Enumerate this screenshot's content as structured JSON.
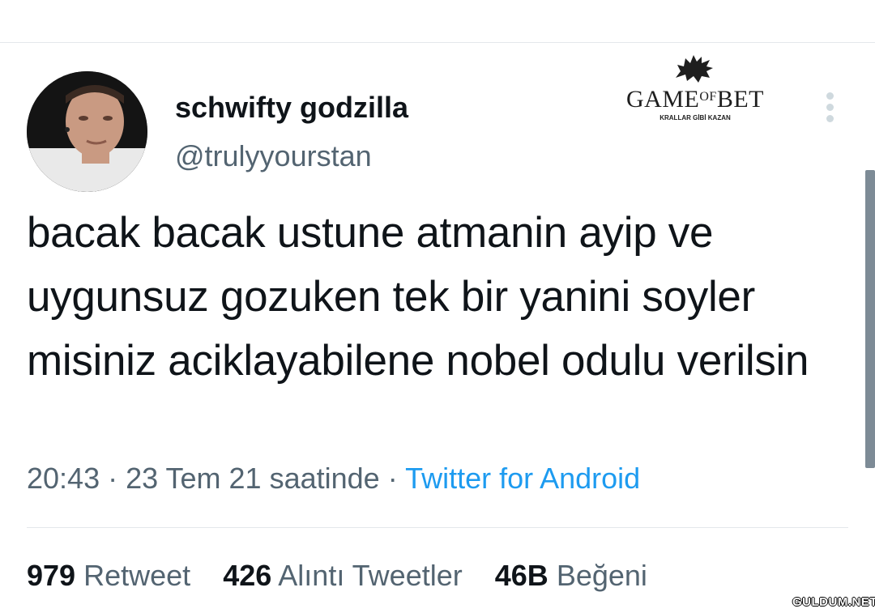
{
  "tweet": {
    "author": {
      "display_name": "schwifty godzilla",
      "handle": "@trulyyourstan"
    },
    "text": "bacak bacak ustune atmanin ayip ve uygunsuz gozuken tek bir yanini soyler misiniz aciklayabilene nobel odulu verilsin",
    "meta": {
      "time": "20:43",
      "separator": "·",
      "date": "23 Tem 21 saatinde",
      "source": "Twitter for Android"
    },
    "stats": [
      {
        "count": "979",
        "label": "Retweet"
      },
      {
        "count": "426",
        "label": "Alıntı Tweetler"
      },
      {
        "count": "46B",
        "label": "Beğeni"
      }
    ]
  },
  "sponsor": {
    "wordmark_left": "GAME",
    "wordmark_of": "OF",
    "wordmark_right": "BET",
    "tagline": "KRALLAR GİBİ KAZAN",
    "icon": "wolf-icon"
  },
  "icons": {
    "more": "more-vertical-icon"
  },
  "watermark": "GULDUM.NET",
  "colors": {
    "primary_text": "#0f1419",
    "secondary_text": "#536471",
    "link": "#1d9bf0",
    "divider": "#e4e8eb"
  }
}
